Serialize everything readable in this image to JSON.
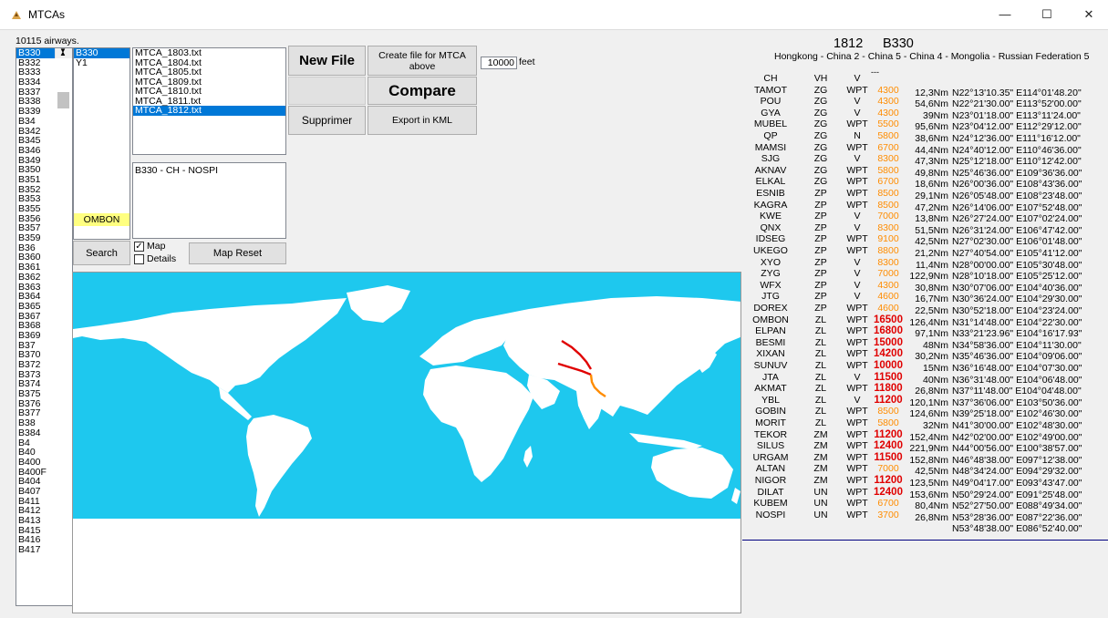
{
  "window": {
    "title": "MTCAs",
    "minimize": "—",
    "maximize": "☐",
    "close": "✕"
  },
  "airways_count": "10115 airways.",
  "airways": [
    "B330",
    "B332",
    "B333",
    "B334",
    "B337",
    "B338",
    "B339",
    "B34",
    "B342",
    "B345",
    "B346",
    "B349",
    "B350",
    "B351",
    "B352",
    "B353",
    "B355",
    "B356",
    "B357",
    "B359",
    "B36",
    "B360",
    "B361",
    "B362",
    "B363",
    "B364",
    "B365",
    "B367",
    "B368",
    "B369",
    "B37",
    "B370",
    "B372",
    "B373",
    "B374",
    "B375",
    "B376",
    "B377",
    "B38",
    "B384",
    "B4",
    "B40",
    "B400",
    "B400F",
    "B404",
    "B407",
    "B411",
    "B412",
    "B413",
    "B415",
    "B416",
    "B417"
  ],
  "variants": [
    "B330",
    "Y1"
  ],
  "highlight_point": "OMBON",
  "files": [
    "MTCA_1803.txt",
    "MTCA_1804.txt",
    "MTCA_1805.txt",
    "MTCA_1809.txt",
    "MTCA_1810.txt",
    "MTCA_1811.txt",
    "MTCA_1812.txt"
  ],
  "route_summary": "B330 - CH - NOSPI",
  "buttons": {
    "new_file": "New File",
    "create_file": "Create file for MTCA above",
    "compare": "Compare",
    "supprimer": "Supprimer",
    "export_kml": "Export in KML",
    "search": "Search",
    "map_reset": "Map Reset"
  },
  "altitude": {
    "value": "10000",
    "unit": "feet"
  },
  "checkboxes": {
    "map": "Map",
    "map_checked": "✓",
    "details": "Details"
  },
  "header": {
    "cycle": "1812",
    "airway": "B330",
    "firs": "Hongkong - China 2 - China 5 - China 4 - Mongolia - Russian Federation 5"
  },
  "first_row_alt": "---",
  "colors": {
    "orange": "#ff8c00",
    "red": "#e00000",
    "ocean": "#1ec8ee",
    "selection": "#0078d7"
  },
  "points": [
    {
      "name": "CH",
      "fir": "VH",
      "type": "V",
      "alt": "",
      "alt_color": "orange",
      "dist": "",
      "coord": ""
    },
    {
      "name": "TAMOT",
      "fir": "ZG",
      "type": "WPT",
      "alt": "4300",
      "alt_color": "orange",
      "dist": "12,3Nm",
      "coord": "N22°13'10.35\" E114°01'48.20\""
    },
    {
      "name": "POU",
      "fir": "ZG",
      "type": "V",
      "alt": "4300",
      "alt_color": "orange",
      "dist": "54,6Nm",
      "coord": "N22°21'30.00\" E113°52'00.00\""
    },
    {
      "name": "GYA",
      "fir": "ZG",
      "type": "V",
      "alt": "4300",
      "alt_color": "orange",
      "dist": "39Nm",
      "coord": "N23°01'18.00\" E113°11'24.00\""
    },
    {
      "name": "MUBEL",
      "fir": "ZG",
      "type": "WPT",
      "alt": "5500",
      "alt_color": "orange",
      "dist": "95,6Nm",
      "coord": "N23°04'12.00\" E112°29'12.00\""
    },
    {
      "name": "QP",
      "fir": "ZG",
      "type": "N",
      "alt": "5800",
      "alt_color": "orange",
      "dist": "38,6Nm",
      "coord": "N24°12'36.00\" E111°16'12.00\""
    },
    {
      "name": "MAMSI",
      "fir": "ZG",
      "type": "WPT",
      "alt": "6700",
      "alt_color": "orange",
      "dist": "44,4Nm",
      "coord": "N24°40'12.00\" E110°46'36.00\""
    },
    {
      "name": "SJG",
      "fir": "ZG",
      "type": "V",
      "alt": "8300",
      "alt_color": "orange",
      "dist": "47,3Nm",
      "coord": "N25°12'18.00\" E110°12'42.00\""
    },
    {
      "name": "AKNAV",
      "fir": "ZG",
      "type": "WPT",
      "alt": "5800",
      "alt_color": "orange",
      "dist": "49,8Nm",
      "coord": "N25°46'36.00\" E109°36'36.00\""
    },
    {
      "name": "ELKAL",
      "fir": "ZG",
      "type": "WPT",
      "alt": "6700",
      "alt_color": "orange",
      "dist": "18,6Nm",
      "coord": "N26°00'36.00\" E108°43'36.00\""
    },
    {
      "name": "ESNIB",
      "fir": "ZP",
      "type": "WPT",
      "alt": "8500",
      "alt_color": "orange",
      "dist": "29,1Nm",
      "coord": "N26°05'48.00\" E108°23'48.00\""
    },
    {
      "name": "KAGRA",
      "fir": "ZP",
      "type": "WPT",
      "alt": "8500",
      "alt_color": "orange",
      "dist": "47,2Nm",
      "coord": "N26°14'06.00\" E107°52'48.00\""
    },
    {
      "name": "KWE",
      "fir": "ZP",
      "type": "V",
      "alt": "7000",
      "alt_color": "orange",
      "dist": "13,8Nm",
      "coord": "N26°27'24.00\" E107°02'24.00\""
    },
    {
      "name": "QNX",
      "fir": "ZP",
      "type": "V",
      "alt": "8300",
      "alt_color": "orange",
      "dist": "51,5Nm",
      "coord": "N26°31'24.00\" E106°47'42.00\""
    },
    {
      "name": "IDSEG",
      "fir": "ZP",
      "type": "WPT",
      "alt": "9100",
      "alt_color": "orange",
      "dist": "42,5Nm",
      "coord": "N27°02'30.00\" E106°01'48.00\""
    },
    {
      "name": "UKEGO",
      "fir": "ZP",
      "type": "WPT",
      "alt": "8800",
      "alt_color": "orange",
      "dist": "21,2Nm",
      "coord": "N27°40'54.00\" E105°41'12.00\""
    },
    {
      "name": "XYO",
      "fir": "ZP",
      "type": "V",
      "alt": "8300",
      "alt_color": "orange",
      "dist": "11,4Nm",
      "coord": "N28°00'00.00\" E105°30'48.00\""
    },
    {
      "name": "ZYG",
      "fir": "ZP",
      "type": "V",
      "alt": "7000",
      "alt_color": "orange",
      "dist": "122,9Nm",
      "coord": "N28°10'18.00\" E105°25'12.00\""
    },
    {
      "name": "WFX",
      "fir": "ZP",
      "type": "V",
      "alt": "4300",
      "alt_color": "orange",
      "dist": "30,8Nm",
      "coord": "N30°07'06.00\" E104°40'36.00\""
    },
    {
      "name": "JTG",
      "fir": "ZP",
      "type": "V",
      "alt": "4600",
      "alt_color": "orange",
      "dist": "16,7Nm",
      "coord": "N30°36'24.00\" E104°29'30.00\""
    },
    {
      "name": "DOREX",
      "fir": "ZP",
      "type": "WPT",
      "alt": "4600",
      "alt_color": "orange",
      "dist": "22,5Nm",
      "coord": "N30°52'18.00\" E104°23'24.00\""
    },
    {
      "name": "OMBON",
      "fir": "ZL",
      "type": "WPT",
      "alt": "16500",
      "alt_color": "red",
      "dist": "126,4Nm",
      "coord": "N31°14'48.00\" E104°22'30.00\""
    },
    {
      "name": "ELPAN",
      "fir": "ZL",
      "type": "WPT",
      "alt": "16800",
      "alt_color": "red",
      "dist": "97,1Nm",
      "coord": "N33°21'23.96\" E104°16'17.93\""
    },
    {
      "name": "BESMI",
      "fir": "ZL",
      "type": "WPT",
      "alt": "15000",
      "alt_color": "red",
      "dist": "48Nm",
      "coord": "N34°58'36.00\" E104°11'30.00\""
    },
    {
      "name": "XIXAN",
      "fir": "ZL",
      "type": "WPT",
      "alt": "14200",
      "alt_color": "red",
      "dist": "30,2Nm",
      "coord": "N35°46'36.00\" E104°09'06.00\""
    },
    {
      "name": "SUNUV",
      "fir": "ZL",
      "type": "WPT",
      "alt": "10000",
      "alt_color": "red",
      "dist": "15Nm",
      "coord": "N36°16'48.00\" E104°07'30.00\""
    },
    {
      "name": "JTA",
      "fir": "ZL",
      "type": "V",
      "alt": "11500",
      "alt_color": "red",
      "dist": "40Nm",
      "coord": "N36°31'48.00\" E104°06'48.00\""
    },
    {
      "name": "AKMAT",
      "fir": "ZL",
      "type": "WPT",
      "alt": "11800",
      "alt_color": "red",
      "dist": "26,8Nm",
      "coord": "N37°11'48.00\" E104°04'48.00\""
    },
    {
      "name": "YBL",
      "fir": "ZL",
      "type": "V",
      "alt": "11200",
      "alt_color": "red",
      "dist": "120,1Nm",
      "coord": "N37°36'06.00\" E103°50'36.00\""
    },
    {
      "name": "GOBIN",
      "fir": "ZL",
      "type": "WPT",
      "alt": "8500",
      "alt_color": "orange",
      "dist": "124,6Nm",
      "coord": "N39°25'18.00\" E102°46'30.00\""
    },
    {
      "name": "MORIT",
      "fir": "ZL",
      "type": "WPT",
      "alt": "5800",
      "alt_color": "orange",
      "dist": "32Nm",
      "coord": "N41°30'00.00\" E102°48'30.00\""
    },
    {
      "name": "TEKOR",
      "fir": "ZM",
      "type": "WPT",
      "alt": "11200",
      "alt_color": "red",
      "dist": "152,4Nm",
      "coord": "N42°02'00.00\" E102°49'00.00\""
    },
    {
      "name": "SILUS",
      "fir": "ZM",
      "type": "WPT",
      "alt": "12400",
      "alt_color": "red",
      "dist": "221,9Nm",
      "coord": "N44°00'56.00\" E100°38'57.00\""
    },
    {
      "name": "URGAM",
      "fir": "ZM",
      "type": "WPT",
      "alt": "11500",
      "alt_color": "red",
      "dist": "152,8Nm",
      "coord": "N46°48'38.00\" E097°12'38.00\""
    },
    {
      "name": "ALTAN",
      "fir": "ZM",
      "type": "WPT",
      "alt": "7000",
      "alt_color": "orange",
      "dist": "42,5Nm",
      "coord": "N48°34'24.00\" E094°29'32.00\""
    },
    {
      "name": "NIGOR",
      "fir": "ZM",
      "type": "WPT",
      "alt": "11200",
      "alt_color": "red",
      "dist": "123,5Nm",
      "coord": "N49°04'17.00\" E093°43'47.00\""
    },
    {
      "name": "DILAT",
      "fir": "UN",
      "type": "WPT",
      "alt": "12400",
      "alt_color": "red",
      "dist": "153,6Nm",
      "coord": "N50°29'24.00\" E091°25'48.00\""
    },
    {
      "name": "KUBEM",
      "fir": "UN",
      "type": "WPT",
      "alt": "6700",
      "alt_color": "orange",
      "dist": "80,4Nm",
      "coord": "N52°27'50.00\" E088°49'34.00\""
    },
    {
      "name": "NOSPI",
      "fir": "UN",
      "type": "WPT",
      "alt": "3700",
      "alt_color": "orange",
      "dist": "26,8Nm",
      "coord": "N53°28'36.00\" E087°22'36.00\""
    }
  ],
  "last_coord": "N53°48'38.00\" E086°52'40.00\""
}
